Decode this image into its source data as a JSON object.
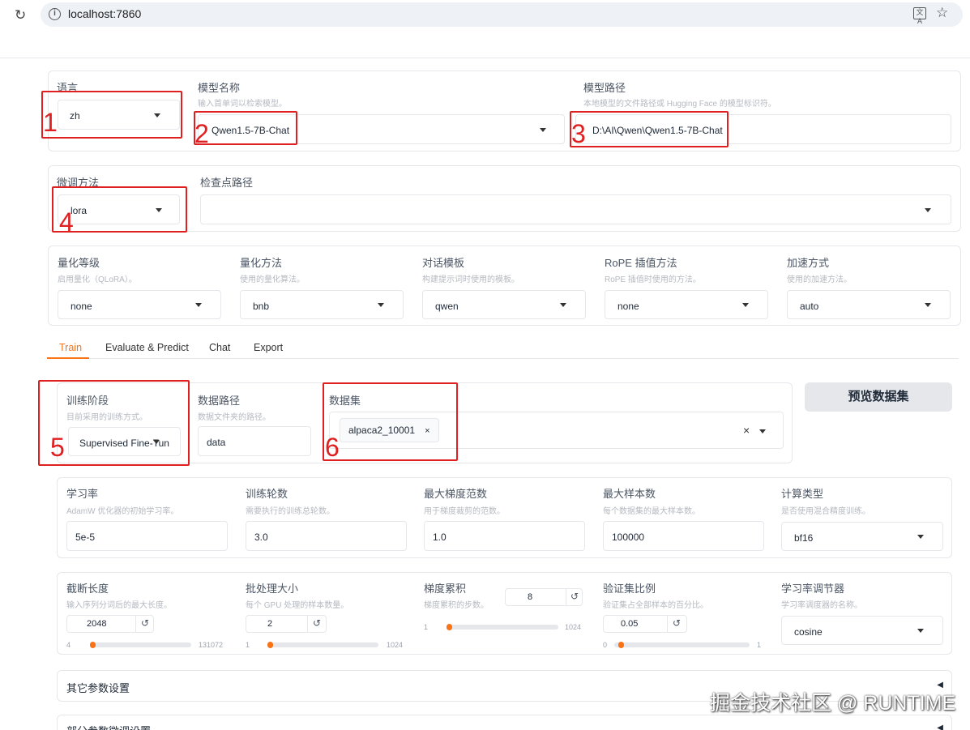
{
  "browser": {
    "url": "localhost:7860",
    "reload_icon": "reload-icon",
    "info_icon": "site-info-icon",
    "translate_icon": "translate-icon",
    "star_icon": "bookmark-star-icon"
  },
  "top": {
    "lang": {
      "label": "语言",
      "value": "zh"
    },
    "model_name": {
      "label": "模型名称",
      "info": "输入首单词以检索模型。",
      "value": "Qwen1.5-7B-Chat"
    },
    "model_path": {
      "label": "模型路径",
      "info": "本地模型的文件路径或 Hugging Face 的模型标识符。",
      "value": "D:\\AI\\Qwen\\Qwen1.5-7B-Chat"
    },
    "finetune": {
      "label": "微调方法",
      "value": "lora"
    },
    "checkpoint": {
      "label": "检查点路径",
      "value": ""
    },
    "quant_bit": {
      "label": "量化等级",
      "info": "启用量化（QLoRA）。",
      "value": "none"
    },
    "quant_method": {
      "label": "量化方法",
      "info": "使用的量化算法。",
      "value": "bnb"
    },
    "template": {
      "label": "对话模板",
      "info": "构建提示词时使用的模板。",
      "value": "qwen"
    },
    "rope": {
      "label": "RoPE 插值方法",
      "info": "RoPE 插值时使用的方法。",
      "value": "none"
    },
    "booster": {
      "label": "加速方式",
      "info": "使用的加速方法。",
      "value": "auto"
    }
  },
  "tabs": [
    "Train",
    "Evaluate & Predict",
    "Chat",
    "Export"
  ],
  "train": {
    "stage": {
      "label": "训练阶段",
      "info": "目前采用的训练方式。",
      "value": "Supervised Fine-Tun"
    },
    "data_dir": {
      "label": "数据路径",
      "info": "数据文件夹的路径。",
      "value": "data"
    },
    "dataset": {
      "label": "数据集",
      "chip": "alpaca2_10001",
      "chip_remove": "×",
      "clear": "×"
    },
    "preview_button": "预览数据集",
    "lr": {
      "label": "学习率",
      "info": "AdamW 优化器的初始学习率。",
      "value": "5e-5"
    },
    "epochs": {
      "label": "训练轮数",
      "info": "需要执行的训练总轮数。",
      "value": "3.0"
    },
    "max_grad_norm": {
      "label": "最大梯度范数",
      "info": "用于梯度裁剪的范数。",
      "value": "1.0"
    },
    "max_samples": {
      "label": "最大样本数",
      "info": "每个数据集的最大样本数。",
      "value": "100000"
    },
    "compute_type": {
      "label": "计算类型",
      "info": "是否使用混合精度训练。",
      "value": "bf16"
    },
    "cutoff_len": {
      "label": "截断长度",
      "info": "输入序列分词后的最大长度。",
      "value": "2048",
      "min": "4",
      "max": "131072",
      "fraction": 0.015
    },
    "batch_size": {
      "label": "批处理大小",
      "info": "每个 GPU 处理的样本数量。",
      "value": "2",
      "min": "1",
      "max": "1024",
      "fraction": 0.001
    },
    "grad_accum": {
      "label": "梯度累积",
      "info": "梯度累积的步数。",
      "value": "8",
      "min": "1",
      "max": "1024",
      "fraction": 0.007
    },
    "val_size": {
      "label": "验证集比例",
      "info": "验证集占全部样本的百分比。",
      "value": "0.05",
      "min": "0",
      "max": "1",
      "fraction": 0.05
    },
    "lr_scheduler": {
      "label": "学习率调节器",
      "info": "学习率调度器的名称。",
      "value": "cosine"
    },
    "reset_icon": "↺"
  },
  "accordions": [
    {
      "title": "其它参数设置",
      "arrow": "◀"
    },
    {
      "title": "部分参数微调设置",
      "arrow": "◀"
    }
  ],
  "annotations": [
    "1",
    "2",
    "3",
    "4",
    "5",
    "6"
  ],
  "watermark": "掘金技术社区 @ RUNTIME",
  "colors": {
    "accent": "#f97316",
    "annotation": "#e02020",
    "border": "#e5e7eb"
  }
}
